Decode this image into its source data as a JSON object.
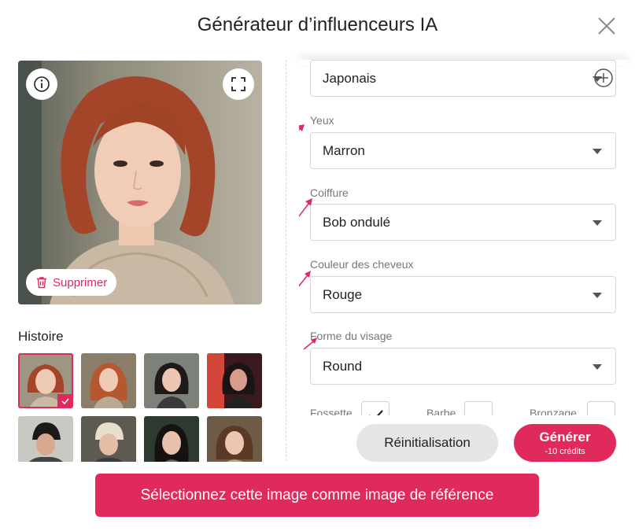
{
  "dialog": {
    "title": "Générateur d’influenceurs IA"
  },
  "preview": {
    "delete_label": "Supprimer",
    "icons": [
      "info-icon",
      "fullscreen-icon",
      "trash-icon"
    ]
  },
  "history": {
    "title": "Histoire",
    "thumbnails": [
      {
        "selected": true
      },
      {
        "selected": false
      },
      {
        "selected": false
      },
      {
        "selected": false
      },
      {
        "selected": false
      },
      {
        "selected": false
      },
      {
        "selected": false
      },
      {
        "selected": false
      }
    ]
  },
  "form": {
    "ethnicity_value": "Japonais",
    "fields": [
      {
        "label": "Yeux",
        "value": "Marron"
      },
      {
        "label": "Coiffure",
        "value": "Bob ondulé"
      },
      {
        "label": "Couleur des cheveux",
        "value": "Rouge"
      },
      {
        "label": "Forme du visage",
        "value": "Round"
      }
    ],
    "checkboxes": [
      {
        "label": "Fossette",
        "checked": true
      },
      {
        "label": "Barbe",
        "checked": false
      },
      {
        "label": "Bronzage",
        "checked": false
      }
    ]
  },
  "actions": {
    "reset_label": "Réinitialisation",
    "generate_label": "Générer",
    "generate_cost": "-10 crédits",
    "reference_label": "Sélectionnez cette image comme image de référence"
  },
  "colors": {
    "accent": "#e0295d",
    "annotation_arrow": "#e0295d",
    "secondary_button": "#e5e5e5"
  }
}
